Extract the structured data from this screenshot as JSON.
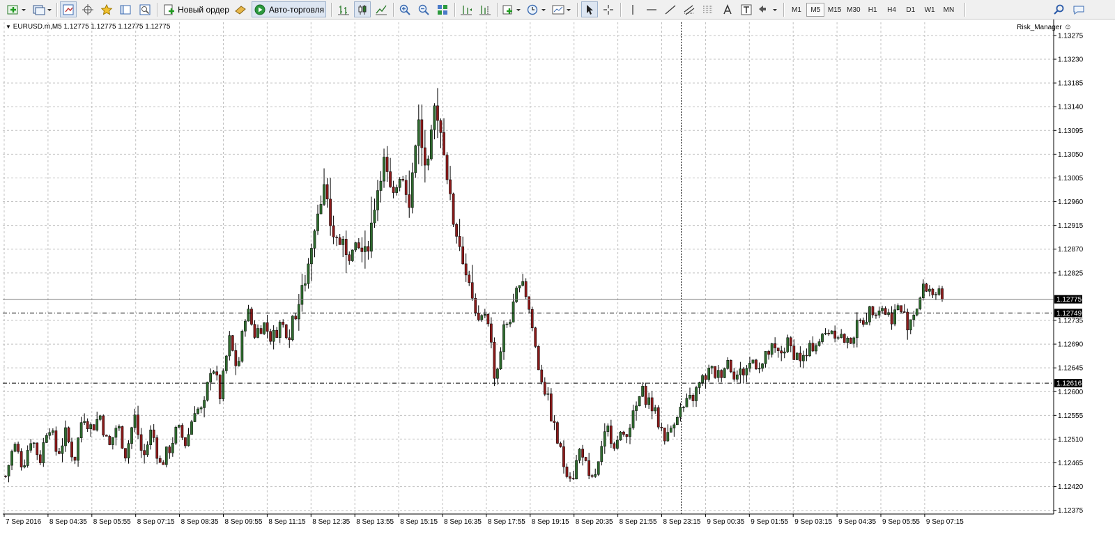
{
  "toolbar": {
    "new_order_label": "Новый ордер",
    "autotrading_label": "Авто-торговля",
    "timeframes": [
      "M1",
      "M5",
      "M15",
      "M30",
      "H1",
      "H4",
      "D1",
      "W1",
      "MN"
    ],
    "active_timeframe": "M5"
  },
  "chart": {
    "title": "EURUSD.m,M5  1.12775 1.12775 1.12775 1.12775",
    "expert_name": "Risk_Manager",
    "expert_icon": "smiley-icon",
    "colors": {
      "background": "#ffffff",
      "grid": "#c0c0c0",
      "bull_candle": "#2e6b2e",
      "bear_candle": "#8b1a1a",
      "line": "#000000",
      "price_tag": "#000000"
    }
  },
  "chart_data": {
    "type": "candlestick",
    "symbol": "EURUSD.m",
    "timeframe": "M5",
    "ylim": [
      1.12375,
      1.12275
    ],
    "y_range": [
      1.12368,
      1.133
    ],
    "y_ticks": [
      "1.13275",
      "1.13230",
      "1.13185",
      "1.13140",
      "1.13095",
      "1.13050",
      "1.13005",
      "1.12960",
      "1.12915",
      "1.12870",
      "1.12825",
      "1.12735",
      "1.12690",
      "1.12645",
      "1.12600",
      "1.12555",
      "1.12510",
      "1.12465",
      "1.12420",
      "1.12375"
    ],
    "x_ticks": [
      "7 Sep 2016",
      "8 Sep 04:35",
      "8 Sep 05:55",
      "8 Sep 07:15",
      "8 Sep 08:35",
      "8 Sep 09:55",
      "8 Sep 11:15",
      "8 Sep 12:35",
      "8 Sep 13:55",
      "8 Sep 15:15",
      "8 Sep 16:35",
      "8 Sep 17:55",
      "8 Sep 19:15",
      "8 Sep 20:35",
      "8 Sep 21:55",
      "8 Sep 23:15",
      "9 Sep 00:35",
      "9 Sep 01:55",
      "9 Sep 03:15",
      "9 Sep 04:35",
      "9 Sep 05:55",
      "9 Sep 07:15"
    ],
    "price_lines": [
      {
        "value": 1.12775,
        "label": "1.12775",
        "style": "solid",
        "kind": "bid"
      },
      {
        "value": 1.12749,
        "label": "1.12749",
        "style": "dashed"
      },
      {
        "value": 1.12616,
        "label": "1.12616",
        "style": "dashed"
      }
    ],
    "crosshair_x_label": "8 Sep 23:15",
    "path": [
      1.1244,
      1.125,
      1.1246,
      1.12515,
      1.1247,
      1.12545,
      1.1248,
      1.1252,
      1.1247,
      1.1256,
      1.1253,
      1.12555,
      1.1249,
      1.1254,
      1.1248,
      1.12555,
      1.1247,
      1.1253,
      1.1246,
      1.1249,
      1.1253,
      1.125,
      1.1257,
      1.1256,
      1.1266,
      1.1259,
      1.127,
      1.1264,
      1.1276,
      1.1271,
      1.1273,
      1.127,
      1.1273,
      1.1271,
      1.1276,
      1.1282,
      1.1292,
      1.1299,
      1.129,
      1.1288,
      1.1286,
      1.1287,
      1.1286,
      1.1296,
      1.1304,
      1.1296,
      1.1302,
      1.1296,
      1.1312,
      1.13,
      1.1315,
      1.1306,
      1.1293,
      1.1287,
      1.1279,
      1.1272,
      1.1276,
      1.1262,
      1.1272,
      1.1275,
      1.1283,
      1.1275,
      1.1265,
      1.1259,
      1.1252,
      1.1246,
      1.1244,
      1.125,
      1.1242,
      1.1246,
      1.1253,
      1.125,
      1.1252,
      1.1255,
      1.126,
      1.1258,
      1.1254,
      1.1251,
      1.1256,
      1.1257,
      1.1259,
      1.1262,
      1.1264,
      1.1263,
      1.1266,
      1.1263,
      1.1264,
      1.1266,
      1.1265,
      1.1268,
      1.1267,
      1.1269,
      1.1267,
      1.1266,
      1.1269,
      1.127,
      1.1272,
      1.1271,
      1.1269,
      1.1272,
      1.1274,
      1.1276,
      1.1276,
      1.1274,
      1.1276,
      1.1273,
      1.1276,
      1.128,
      1.1279,
      1.12775
    ]
  }
}
